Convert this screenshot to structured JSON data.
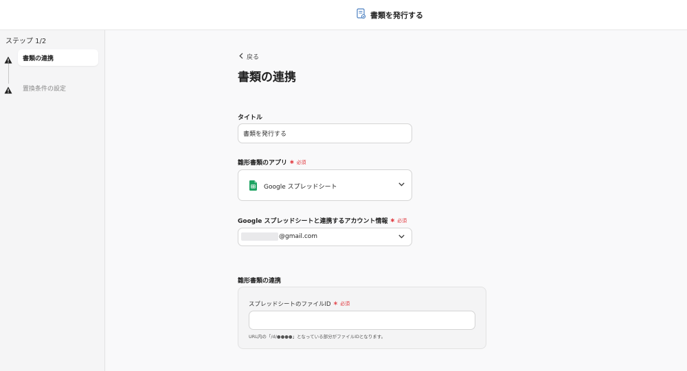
{
  "header": {
    "title": "書類を発行する",
    "icon": "document-icon"
  },
  "sidebar": {
    "step_counter": "ステップ 1/2",
    "steps": [
      {
        "label": "書類の連携",
        "state": "active",
        "icon": "warning-icon"
      },
      {
        "label": "置換条件の設定",
        "state": "inactive",
        "icon": "warning-icon"
      }
    ]
  },
  "main": {
    "back_label": "戻る",
    "title": "書類の連携",
    "title_field": {
      "label": "タイトル",
      "value": "書類を発行する"
    },
    "template_app": {
      "label": "雛形書類のアプリ",
      "required_text": "必須",
      "selected": "Google スプレッドシート",
      "app_icon": "google-sheets-icon"
    },
    "account": {
      "label": "Google スプレッドシートと連携するアカウント情報",
      "required_text": "必須",
      "value": "@gmail.com"
    },
    "template_link": {
      "section_label": "雛形書類の連携",
      "file_id_label": "スプレッドシートのファイルID",
      "required_text": "必須",
      "file_id_value": "",
      "hint": "URL内の「/d/●●●●」となっている部分がファイルIDとなります。"
    }
  },
  "colors": {
    "required": "#e0353b",
    "sheets_green": "#1fa463",
    "border": "#d4d4d4"
  }
}
